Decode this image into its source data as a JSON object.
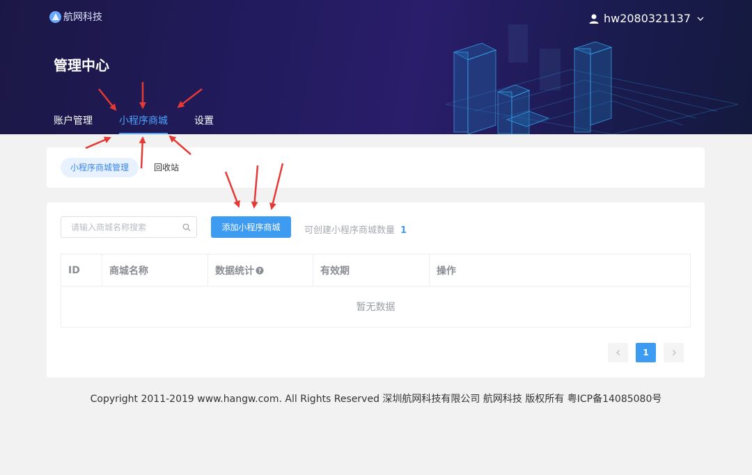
{
  "header": {
    "logo_text": "航网科技",
    "username": "hw2080321137",
    "page_title": "管理中心",
    "nav": [
      {
        "label": "账户管理",
        "active": false
      },
      {
        "label": "小程序商城",
        "active": true
      },
      {
        "label": "设置",
        "active": false
      }
    ]
  },
  "subtabs": [
    {
      "label": "小程序商城管理",
      "active": true
    },
    {
      "label": "回收站",
      "active": false
    }
  ],
  "toolbar": {
    "search_placeholder": "请输入商城名称搜索",
    "search_value": "",
    "add_button_label": "添加小程序商城",
    "quota_label": "可创建小程序商城数量",
    "quota_value": "1"
  },
  "table": {
    "columns": [
      "ID",
      "商城名称",
      "数据统计",
      "有效期",
      "操作"
    ],
    "rows": [],
    "empty_text": "暂无数据"
  },
  "pagination": {
    "current_page": "1",
    "prev_icon": "chevron-left-icon",
    "next_icon": "chevron-right-icon"
  },
  "footer": {
    "copyright": "Copyright 2011-2019 www.hangw.com. All Rights Reserved 深圳航网科技有限公司 航网科技 版权所有 粤ICP备14085080号"
  },
  "colors": {
    "accent": "#3d9bf2",
    "nav_active": "#4da3ff",
    "annotation_arrow": "#e53935"
  }
}
